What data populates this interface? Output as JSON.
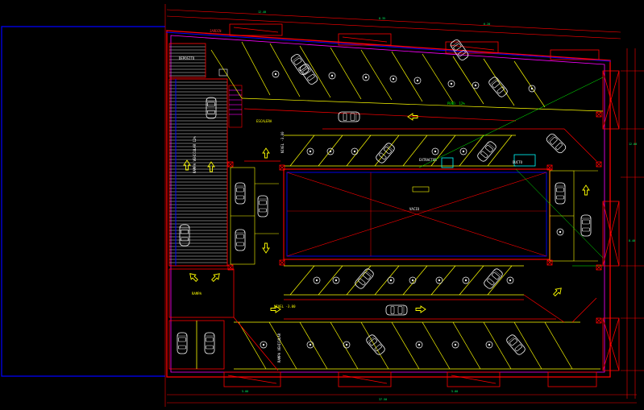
{
  "drawing": {
    "labels": {
      "void": "VACIO",
      "stair_note": "ESCALERA",
      "ramp_note": "RAMPA",
      "room_top_left": "DEPOSITO",
      "ramp_side": "RAMPA VEHICULAR 12%",
      "ramp_bottom": "RAMPA VEHICULAR",
      "slope_note": "PEND. 12%",
      "garden": "JARDIN",
      "extractor": "EXTRACTOR",
      "duct": "DUCTO",
      "mid_note": "NIVEL -3.00",
      "bottom_note": "NIVEL -3.00"
    },
    "colors": {
      "background": "#000000",
      "boundary": "#0000ff",
      "walls": "#ff0000",
      "inner_walls": "#ff00ff",
      "parking_lines": "#ffff00",
      "dimensions": "#00ff00",
      "cars": "#ffffff",
      "arrows": "#ffff00"
    },
    "symbols": [
      "car-icon",
      "arrow-icon",
      "column-icon",
      "stair-icon",
      "ramp-hatch"
    ]
  }
}
